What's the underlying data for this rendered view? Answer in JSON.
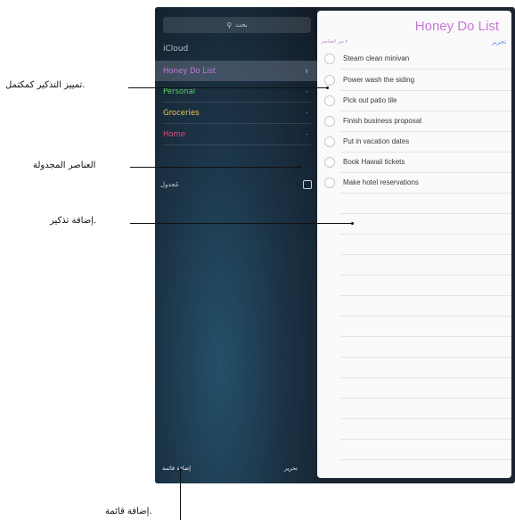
{
  "sidebar": {
    "search_placeholder": "بحث",
    "section": "iCloud",
    "lists": [
      {
        "name": "Honey Do List",
        "count": "٧",
        "color": "#c678d8"
      },
      {
        "name": "Personal",
        "count": "-",
        "color": "#5fd46a"
      },
      {
        "name": "Groceries",
        "count": "-",
        "color": "#f2c94c"
      },
      {
        "name": "Home",
        "count": "-",
        "color": "#e8497e"
      }
    ],
    "scheduled": "مُجدول",
    "add_list": "إضافة قائمة",
    "edit": "تحرير"
  },
  "detail": {
    "title": "Honey Do List",
    "edit": "تحرير",
    "items_count": "٧ من العناصر",
    "items": [
      "Steam clean minivan",
      "Power wash the siding",
      "Pick out patio tile",
      "Finish business proposal",
      "Put in vacation dates",
      "Book Hawaii tickets",
      "Make hotel reservations"
    ]
  },
  "callouts": {
    "mark_complete": "تمييز التذكير كمكتمل.",
    "scheduled_items": "العناصر المجدولة",
    "add_reminder": "إضافة تذكير.",
    "add_list": "إضافة قائمة."
  }
}
